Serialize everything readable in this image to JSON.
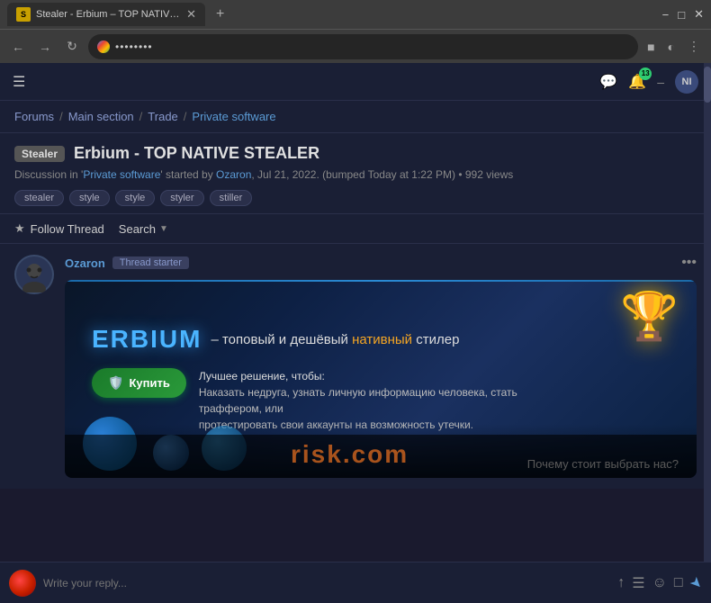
{
  "browser": {
    "tab_title": "Stealer - Erbium – TOP NATIVE S…",
    "favicon_text": "S",
    "address_bar_text": "••••••••",
    "window_minimize": "−",
    "window_maximize": "□",
    "window_close": "✕"
  },
  "topbar": {
    "notification_count": "13",
    "avatar_text": "NI"
  },
  "breadcrumb": {
    "forums": "Forums",
    "sep1": "/",
    "main_section": "Main section",
    "sep2": "/",
    "trade": "Trade",
    "sep3": "/",
    "private_software": "Private software"
  },
  "thread": {
    "tag": "Stealer",
    "title": "Erbium - TOP NATIVE STEALER",
    "meta_prefix": "Discussion in '",
    "meta_forum": "Private software",
    "meta_middle": "' started by ",
    "meta_user": "Ozaron",
    "meta_date": ", Jul 21, 2022.",
    "meta_bumped": "(bumped Today at 1:22 PM)",
    "meta_views": "992 views",
    "tags": [
      "stealer",
      "style",
      "style",
      "styler",
      "stiller"
    ]
  },
  "actions": {
    "follow_thread": "Follow Thread",
    "search": "Search"
  },
  "post": {
    "username": "Ozaron",
    "badge": "Thread starter",
    "more_btn": "•••"
  },
  "banner": {
    "logo": "ERBIUM",
    "subtitle_prefix": "– топовый и дешёвый ",
    "subtitle_highlight": "нативный",
    "subtitle_suffix": " стилер",
    "buy_btn": "Купить",
    "buy_desc_line1": "Лучшее решение, чтобы:",
    "buy_desc_line2": "Наказать недруга, узнать личную информацию человека, стать траффером, или",
    "buy_desc_line3": "протестировать свои аккаунты на возможность утечки.",
    "bottom_text": "Почему стоит выбрать нас?",
    "watermark": "risk.com"
  },
  "reply_bar": {
    "placeholder": "Write your reply..."
  }
}
